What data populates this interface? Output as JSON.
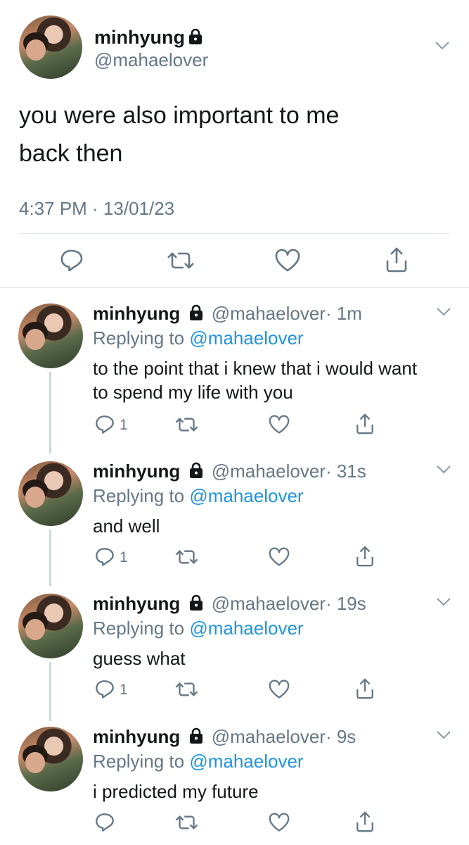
{
  "main_tweet": {
    "display_name": "minhyung",
    "handle": "@mahaelover",
    "text_line1": "you were also important to me",
    "text_line2": "back then",
    "timestamp": "4:37 PM · 13/01/23",
    "icons": [
      "reply-icon",
      "retweet-icon",
      "like-icon",
      "share-icon"
    ]
  },
  "replies": [
    {
      "display_name": "minhyung",
      "handle": "@mahaelover",
      "time": "· 1m",
      "replying_prefix": "Replying to",
      "replying_to": "@mahaelover",
      "text_line1": "to the point that i knew that i would want",
      "text_line2": "to spend my life with you",
      "reply_count": "1"
    },
    {
      "display_name": "minhyung",
      "handle": "@mahaelover",
      "time": "· 31s",
      "replying_prefix": "Replying to",
      "replying_to": "@mahaelover",
      "text_line1": "and well",
      "reply_count": "1"
    },
    {
      "display_name": "minhyung",
      "handle": "@mahaelover",
      "time": "· 19s",
      "replying_prefix": "Replying to",
      "replying_to": "@mahaelover",
      "text_line1": "guess what",
      "reply_count": "1"
    },
    {
      "display_name": "minhyung",
      "handle": "@mahaelover",
      "time": "· 9s",
      "replying_prefix": "Replying to",
      "replying_to": "@mahaelover",
      "text_line1": "i predicted my future",
      "reply_count": ""
    }
  ],
  "colors": {
    "text": "#14171a",
    "secondary": "#657786",
    "link": "#1b95e0",
    "divider": "#e1e8ed",
    "thread_line": "#ccd6dd"
  }
}
